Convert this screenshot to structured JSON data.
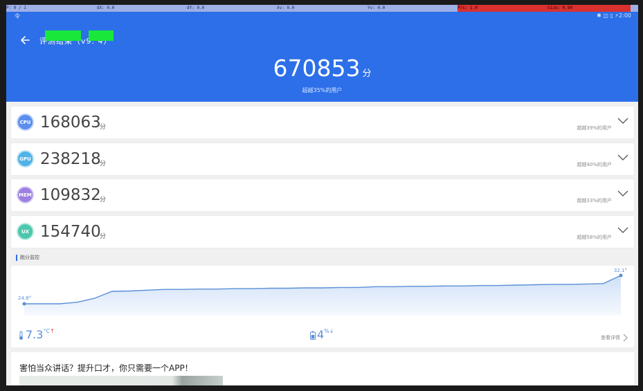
{
  "debug": {
    "p": "P: 0 / 1",
    "dx": "dX: 0.0",
    "dy": "dY: 0.0",
    "xv": "Xv: 0.0",
    "yv": "Yv: 0.0",
    "prs": "Prs: 1.0",
    "size": "Size: 0.90"
  },
  "status_bar": {
    "left": "令",
    "right": "✱ ◫ ▯ ⚡2:00"
  },
  "header": {
    "title": "评测结果（v9.  4）",
    "total_score": "670853",
    "score_unit": "分",
    "beat_text": "超越35%的用户"
  },
  "categories": [
    {
      "badge": "CPU",
      "score": "168063",
      "unit": "分",
      "beat": "超越39%的用户",
      "color": "#5b8def"
    },
    {
      "badge": "GPU",
      "score": "238218",
      "unit": "分",
      "beat": "超越40%的用户",
      "color": "#4fb3e8"
    },
    {
      "badge": "MEM",
      "score": "109832",
      "unit": "分",
      "beat": "超越33%的用户",
      "color": "#9c7fe0"
    },
    {
      "badge": "UX",
      "score": "154740",
      "unit": "分",
      "beat": "超越58%的用户",
      "color": "#4cc7ae"
    }
  ],
  "monitor": {
    "section_title": "跑分监控",
    "start_temp_label": "24.8°",
    "end_temp_label": "32.1°",
    "temp_change": "7.3",
    "temp_unit": "°C",
    "temp_arrow": "↑",
    "battery_change": "4",
    "battery_unit": "%",
    "battery_arrow": "↓",
    "details_label": "查看详情",
    "line_color": "#5a8fd6",
    "temps": [
      24.8,
      24.8,
      24.8,
      25.2,
      26.2,
      28.0,
      28.1,
      28.3,
      28.5,
      28.5,
      28.6,
      28.6,
      28.7,
      28.7,
      28.8,
      28.8,
      28.9,
      28.9,
      29.0,
      29.0,
      29.2,
      29.2,
      29.3,
      29.3,
      29.4,
      29.4,
      29.5,
      29.5,
      29.6,
      29.7,
      29.8,
      29.8,
      29.9,
      30.0,
      32.1
    ]
  },
  "ad": {
    "text": "害怕当众讲话？提升口才，你只需要一个APP！"
  }
}
